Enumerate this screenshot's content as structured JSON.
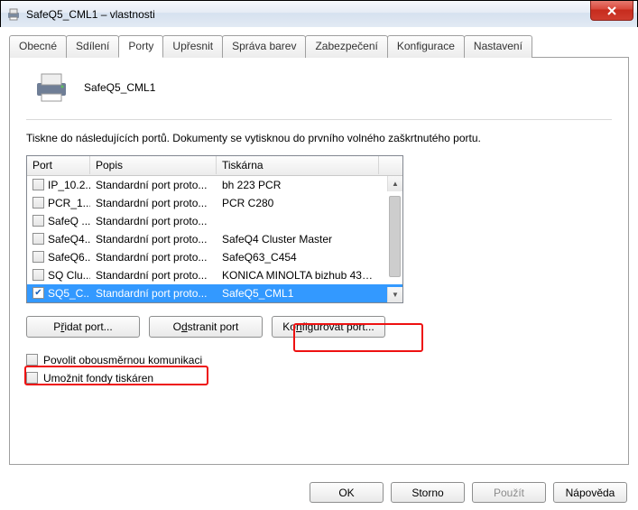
{
  "window": {
    "title": "SafeQ5_CML1 – vlastnosti"
  },
  "tabs": [
    {
      "label": "Obecné"
    },
    {
      "label": "Sdílení"
    },
    {
      "label": "Porty"
    },
    {
      "label": "Upřesnit"
    },
    {
      "label": "Správa barev"
    },
    {
      "label": "Zabezpečení"
    },
    {
      "label": "Konfigurace"
    },
    {
      "label": "Nastavení"
    }
  ],
  "printer_name": "SafeQ5_CML1",
  "description": "Tiskne do následujících portů. Dokumenty se vytisknou do prvního volného zaškrtnutého portu.",
  "columns": {
    "port": "Port",
    "desc": "Popis",
    "printer": "Tiskárna"
  },
  "ports": [
    {
      "checked": false,
      "port": "IP_10.2...",
      "desc": "Standardní port proto...",
      "printer": "bh 223 PCR"
    },
    {
      "checked": false,
      "port": "PCR_1...",
      "desc": "Standardní port proto...",
      "printer": "PCR C280"
    },
    {
      "checked": false,
      "port": "SafeQ ...",
      "desc": "Standardní port proto...",
      "printer": ""
    },
    {
      "checked": false,
      "port": "SafeQ4...",
      "desc": "Standardní port proto...",
      "printer": "SafeQ4 Cluster Master"
    },
    {
      "checked": false,
      "port": "SafeQ6...",
      "desc": "Standardní port proto...",
      "printer": "SafeQ63_C454"
    },
    {
      "checked": false,
      "port": "SQ Clu...",
      "desc": "Standardní port proto...",
      "printer": "KONICA MINOLTA bizhub 43 P..."
    },
    {
      "checked": true,
      "port": "SQ5_C...",
      "desc": "Standardní port proto...",
      "printer": "SafeQ5_CML1"
    }
  ],
  "buttons": {
    "add_pre": "P",
    "add_ul": "ř",
    "add_post": "idat port...",
    "del_pre": "O",
    "del_ul": "d",
    "del_post": "stranit port",
    "cfg_pre": "Ko",
    "cfg_ul": "n",
    "cfg_post": "figurovat port..."
  },
  "checks": {
    "bidi_pre": "Povolit obousměrnou komunika",
    "bidi_ul": "c",
    "bidi_post": "i",
    "pool_pre": "Umožnit ",
    "pool_ul": "f",
    "pool_post": "ondy tiskáren"
  },
  "footer": {
    "ok": "OK",
    "cancel": "Storno",
    "apply": "Použít",
    "help": "Nápověda"
  }
}
